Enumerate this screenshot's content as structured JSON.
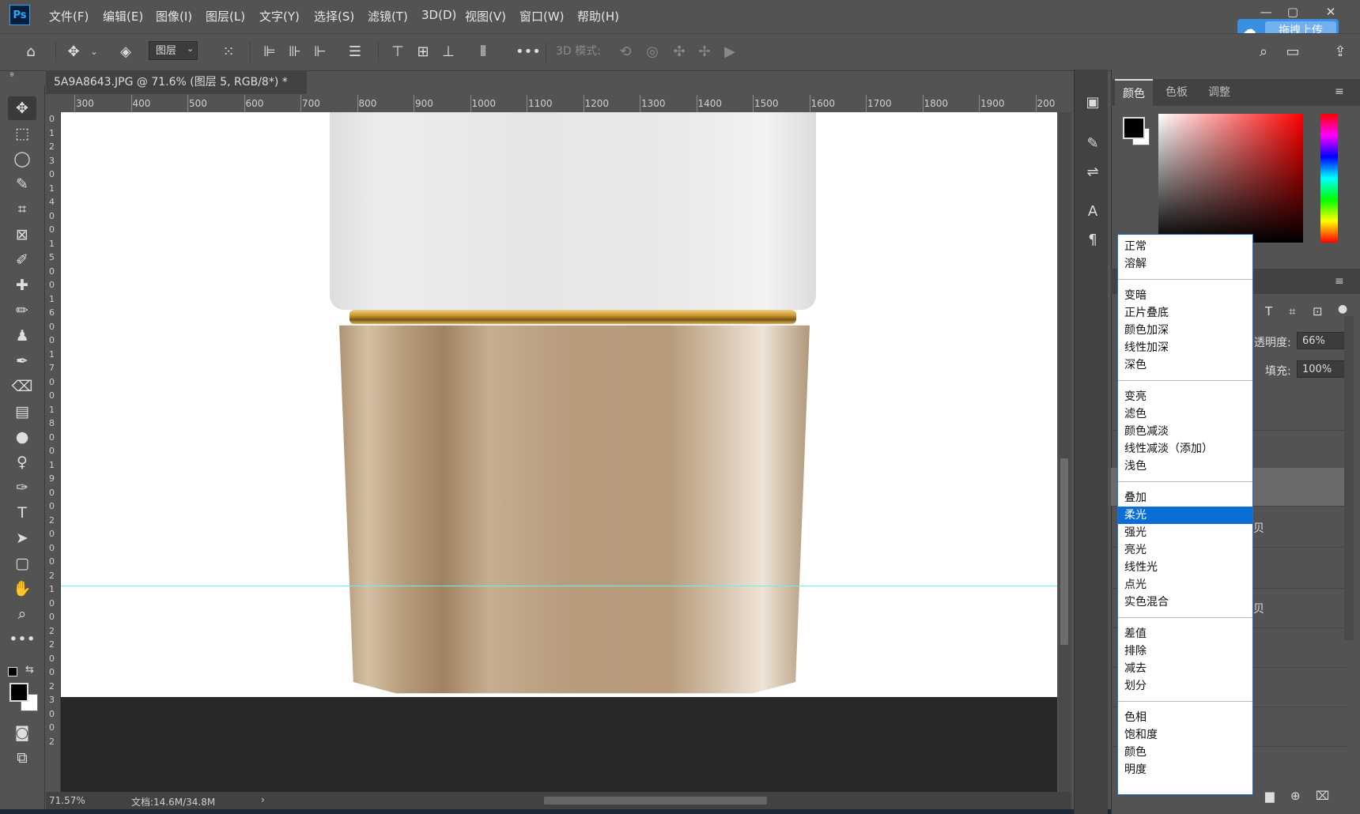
{
  "menubar": {
    "items": [
      "文件(F)",
      "编辑(E)",
      "图像(I)",
      "图层(L)",
      "文字(Y)",
      "选择(S)",
      "滤镜(T)",
      "3D(D)",
      "视图(V)",
      "窗口(W)",
      "帮助(H)"
    ],
    "upload_label": "拖拽上传"
  },
  "options": {
    "layer_select": "图层",
    "mode3d_label": "3D 模式:"
  },
  "document": {
    "tab_title": "5A9A8643.JPG @ 71.6% (图层 5, RGB/8*) *",
    "ruler_top": [
      "300",
      "400",
      "500",
      "600",
      "700",
      "800",
      "900",
      "1000",
      "1100",
      "1200",
      "1300",
      "1400",
      "1500",
      "1600",
      "1700",
      "1800",
      "1900",
      "200"
    ],
    "ruler_left": [
      "0",
      "1",
      "2",
      "3",
      "0",
      "1",
      "4",
      "0",
      "0",
      "1",
      "5",
      "0",
      "0",
      "1",
      "6",
      "0",
      "0",
      "1",
      "7",
      "0",
      "0",
      "1",
      "8",
      "0",
      "0",
      "1",
      "9",
      "0",
      "0",
      "2",
      "0",
      "0",
      "0",
      "2",
      "1",
      "0",
      "0",
      "2",
      "2",
      "0",
      "0",
      "2",
      "3",
      "0",
      "0",
      "2"
    ]
  },
  "status": {
    "zoom": "71.57%",
    "doc_size": "文档:14.6M/34.8M"
  },
  "panel": {
    "tabs": [
      "颜色",
      "色板",
      "调整"
    ],
    "opacity_label": "透明度:",
    "opacity_value": "66%",
    "fill_label": "填充:",
    "fill_value": "100%",
    "row_fragment_1": "贝",
    "row_fragment_2": "贝"
  },
  "blend_menu": {
    "groups": [
      [
        "正常",
        "溶解"
      ],
      [
        "变暗",
        "正片叠底",
        "颜色加深",
        "线性加深",
        "深色"
      ],
      [
        "变亮",
        "滤色",
        "颜色减淡",
        "线性减淡（添加）",
        "浅色"
      ],
      [
        "叠加",
        "柔光",
        "强光",
        "亮光",
        "线性光",
        "点光",
        "实色混合"
      ],
      [
        "差值",
        "排除",
        "减去",
        "划分"
      ],
      [
        "色相",
        "饱和度",
        "颜色",
        "明度"
      ]
    ],
    "selected": "柔光"
  },
  "colors": {
    "accent": "#0b6ed6",
    "guide": "#5ff5f0",
    "upload": "#3b8fe0"
  }
}
